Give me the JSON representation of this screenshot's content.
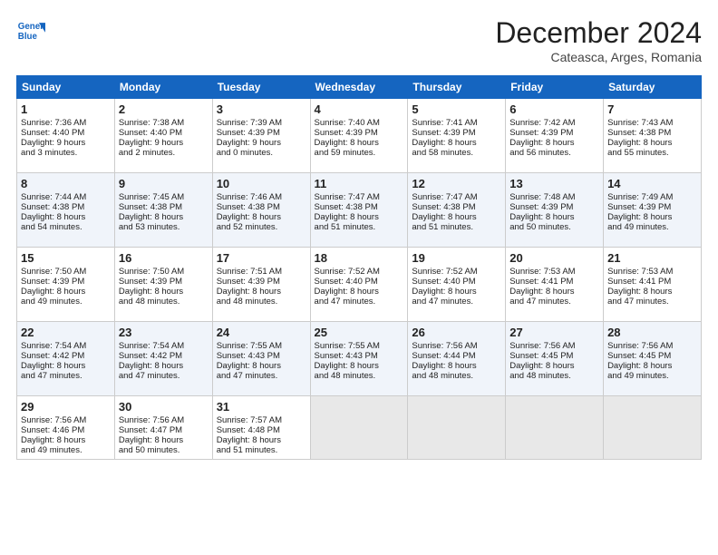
{
  "header": {
    "logo_line1": "General",
    "logo_line2": "Blue",
    "month": "December 2024",
    "location": "Cateasca, Arges, Romania"
  },
  "weekdays": [
    "Sunday",
    "Monday",
    "Tuesday",
    "Wednesday",
    "Thursday",
    "Friday",
    "Saturday"
  ],
  "weeks": [
    [
      {
        "day": "1",
        "lines": [
          "Sunrise: 7:36 AM",
          "Sunset: 4:40 PM",
          "Daylight: 9 hours",
          "and 3 minutes."
        ]
      },
      {
        "day": "2",
        "lines": [
          "Sunrise: 7:38 AM",
          "Sunset: 4:40 PM",
          "Daylight: 9 hours",
          "and 2 minutes."
        ]
      },
      {
        "day": "3",
        "lines": [
          "Sunrise: 7:39 AM",
          "Sunset: 4:39 PM",
          "Daylight: 9 hours",
          "and 0 minutes."
        ]
      },
      {
        "day": "4",
        "lines": [
          "Sunrise: 7:40 AM",
          "Sunset: 4:39 PM",
          "Daylight: 8 hours",
          "and 59 minutes."
        ]
      },
      {
        "day": "5",
        "lines": [
          "Sunrise: 7:41 AM",
          "Sunset: 4:39 PM",
          "Daylight: 8 hours",
          "and 58 minutes."
        ]
      },
      {
        "day": "6",
        "lines": [
          "Sunrise: 7:42 AM",
          "Sunset: 4:39 PM",
          "Daylight: 8 hours",
          "and 56 minutes."
        ]
      },
      {
        "day": "7",
        "lines": [
          "Sunrise: 7:43 AM",
          "Sunset: 4:38 PM",
          "Daylight: 8 hours",
          "and 55 minutes."
        ]
      }
    ],
    [
      {
        "day": "8",
        "lines": [
          "Sunrise: 7:44 AM",
          "Sunset: 4:38 PM",
          "Daylight: 8 hours",
          "and 54 minutes."
        ]
      },
      {
        "day": "9",
        "lines": [
          "Sunrise: 7:45 AM",
          "Sunset: 4:38 PM",
          "Daylight: 8 hours",
          "and 53 minutes."
        ]
      },
      {
        "day": "10",
        "lines": [
          "Sunrise: 7:46 AM",
          "Sunset: 4:38 PM",
          "Daylight: 8 hours",
          "and 52 minutes."
        ]
      },
      {
        "day": "11",
        "lines": [
          "Sunrise: 7:47 AM",
          "Sunset: 4:38 PM",
          "Daylight: 8 hours",
          "and 51 minutes."
        ]
      },
      {
        "day": "12",
        "lines": [
          "Sunrise: 7:47 AM",
          "Sunset: 4:38 PM",
          "Daylight: 8 hours",
          "and 51 minutes."
        ]
      },
      {
        "day": "13",
        "lines": [
          "Sunrise: 7:48 AM",
          "Sunset: 4:39 PM",
          "Daylight: 8 hours",
          "and 50 minutes."
        ]
      },
      {
        "day": "14",
        "lines": [
          "Sunrise: 7:49 AM",
          "Sunset: 4:39 PM",
          "Daylight: 8 hours",
          "and 49 minutes."
        ]
      }
    ],
    [
      {
        "day": "15",
        "lines": [
          "Sunrise: 7:50 AM",
          "Sunset: 4:39 PM",
          "Daylight: 8 hours",
          "and 49 minutes."
        ]
      },
      {
        "day": "16",
        "lines": [
          "Sunrise: 7:50 AM",
          "Sunset: 4:39 PM",
          "Daylight: 8 hours",
          "and 48 minutes."
        ]
      },
      {
        "day": "17",
        "lines": [
          "Sunrise: 7:51 AM",
          "Sunset: 4:39 PM",
          "Daylight: 8 hours",
          "and 48 minutes."
        ]
      },
      {
        "day": "18",
        "lines": [
          "Sunrise: 7:52 AM",
          "Sunset: 4:40 PM",
          "Daylight: 8 hours",
          "and 47 minutes."
        ]
      },
      {
        "day": "19",
        "lines": [
          "Sunrise: 7:52 AM",
          "Sunset: 4:40 PM",
          "Daylight: 8 hours",
          "and 47 minutes."
        ]
      },
      {
        "day": "20",
        "lines": [
          "Sunrise: 7:53 AM",
          "Sunset: 4:41 PM",
          "Daylight: 8 hours",
          "and 47 minutes."
        ]
      },
      {
        "day": "21",
        "lines": [
          "Sunrise: 7:53 AM",
          "Sunset: 4:41 PM",
          "Daylight: 8 hours",
          "and 47 minutes."
        ]
      }
    ],
    [
      {
        "day": "22",
        "lines": [
          "Sunrise: 7:54 AM",
          "Sunset: 4:42 PM",
          "Daylight: 8 hours",
          "and 47 minutes."
        ]
      },
      {
        "day": "23",
        "lines": [
          "Sunrise: 7:54 AM",
          "Sunset: 4:42 PM",
          "Daylight: 8 hours",
          "and 47 minutes."
        ]
      },
      {
        "day": "24",
        "lines": [
          "Sunrise: 7:55 AM",
          "Sunset: 4:43 PM",
          "Daylight: 8 hours",
          "and 47 minutes."
        ]
      },
      {
        "day": "25",
        "lines": [
          "Sunrise: 7:55 AM",
          "Sunset: 4:43 PM",
          "Daylight: 8 hours",
          "and 48 minutes."
        ]
      },
      {
        "day": "26",
        "lines": [
          "Sunrise: 7:56 AM",
          "Sunset: 4:44 PM",
          "Daylight: 8 hours",
          "and 48 minutes."
        ]
      },
      {
        "day": "27",
        "lines": [
          "Sunrise: 7:56 AM",
          "Sunset: 4:45 PM",
          "Daylight: 8 hours",
          "and 48 minutes."
        ]
      },
      {
        "day": "28",
        "lines": [
          "Sunrise: 7:56 AM",
          "Sunset: 4:45 PM",
          "Daylight: 8 hours",
          "and 49 minutes."
        ]
      }
    ],
    [
      {
        "day": "29",
        "lines": [
          "Sunrise: 7:56 AM",
          "Sunset: 4:46 PM",
          "Daylight: 8 hours",
          "and 49 minutes."
        ]
      },
      {
        "day": "30",
        "lines": [
          "Sunrise: 7:56 AM",
          "Sunset: 4:47 PM",
          "Daylight: 8 hours",
          "and 50 minutes."
        ]
      },
      {
        "day": "31",
        "lines": [
          "Sunrise: 7:57 AM",
          "Sunset: 4:48 PM",
          "Daylight: 8 hours",
          "and 51 minutes."
        ]
      },
      null,
      null,
      null,
      null
    ]
  ]
}
